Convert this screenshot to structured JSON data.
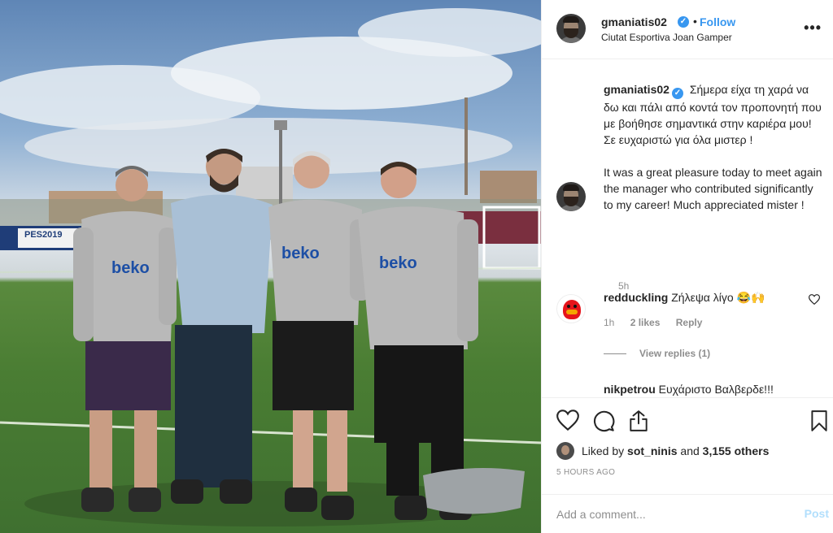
{
  "photo": {
    "alt_icon": "instagram-photo",
    "banner_text": "PES2019",
    "shirt_sponsor": "beko"
  },
  "post": {
    "username": "gmaniatis02",
    "verified_icon": "verified-badge-icon",
    "dot": "•",
    "follow_label": "Follow",
    "location": "Ciutat Esportiva Joan Gamper",
    "more_icon": "•••"
  },
  "caption": {
    "username": "gmaniatis02",
    "text_el": "Σήμερα είχα τη χαρά να δω και πάλι από κοντά τον προπονητή που με βοήθησε σημαντικά στην καριέρα μου! Σε ευχαριστώ για όλα μιστερ !",
    "text_en": "It was a great pleasure today to meet again the manager who contributed significantly to my career! Much appreciated mister !",
    "time": "5h"
  },
  "comments": [
    {
      "username": "redduckling",
      "text": "Ζήλεψα λίγο 😂🙌",
      "time": "1h",
      "likes": "2 likes",
      "reply_label": "Reply",
      "view_replies": "View replies (1)"
    },
    {
      "username": "nikpetrou",
      "text": "Ευχάριστο Βαλβερδε!!!"
    }
  ],
  "likes": {
    "prefix": "Liked by ",
    "user": "sot_ninis",
    "middle": " and ",
    "count": "3,155 others"
  },
  "timestamp": "5 HOURS AGO",
  "add_comment": {
    "placeholder": "Add a comment...",
    "post_label": "Post"
  },
  "colors": {
    "accent": "#3897f0",
    "post_disabled": "#b2dffc",
    "muted": "#8e8e8e"
  }
}
